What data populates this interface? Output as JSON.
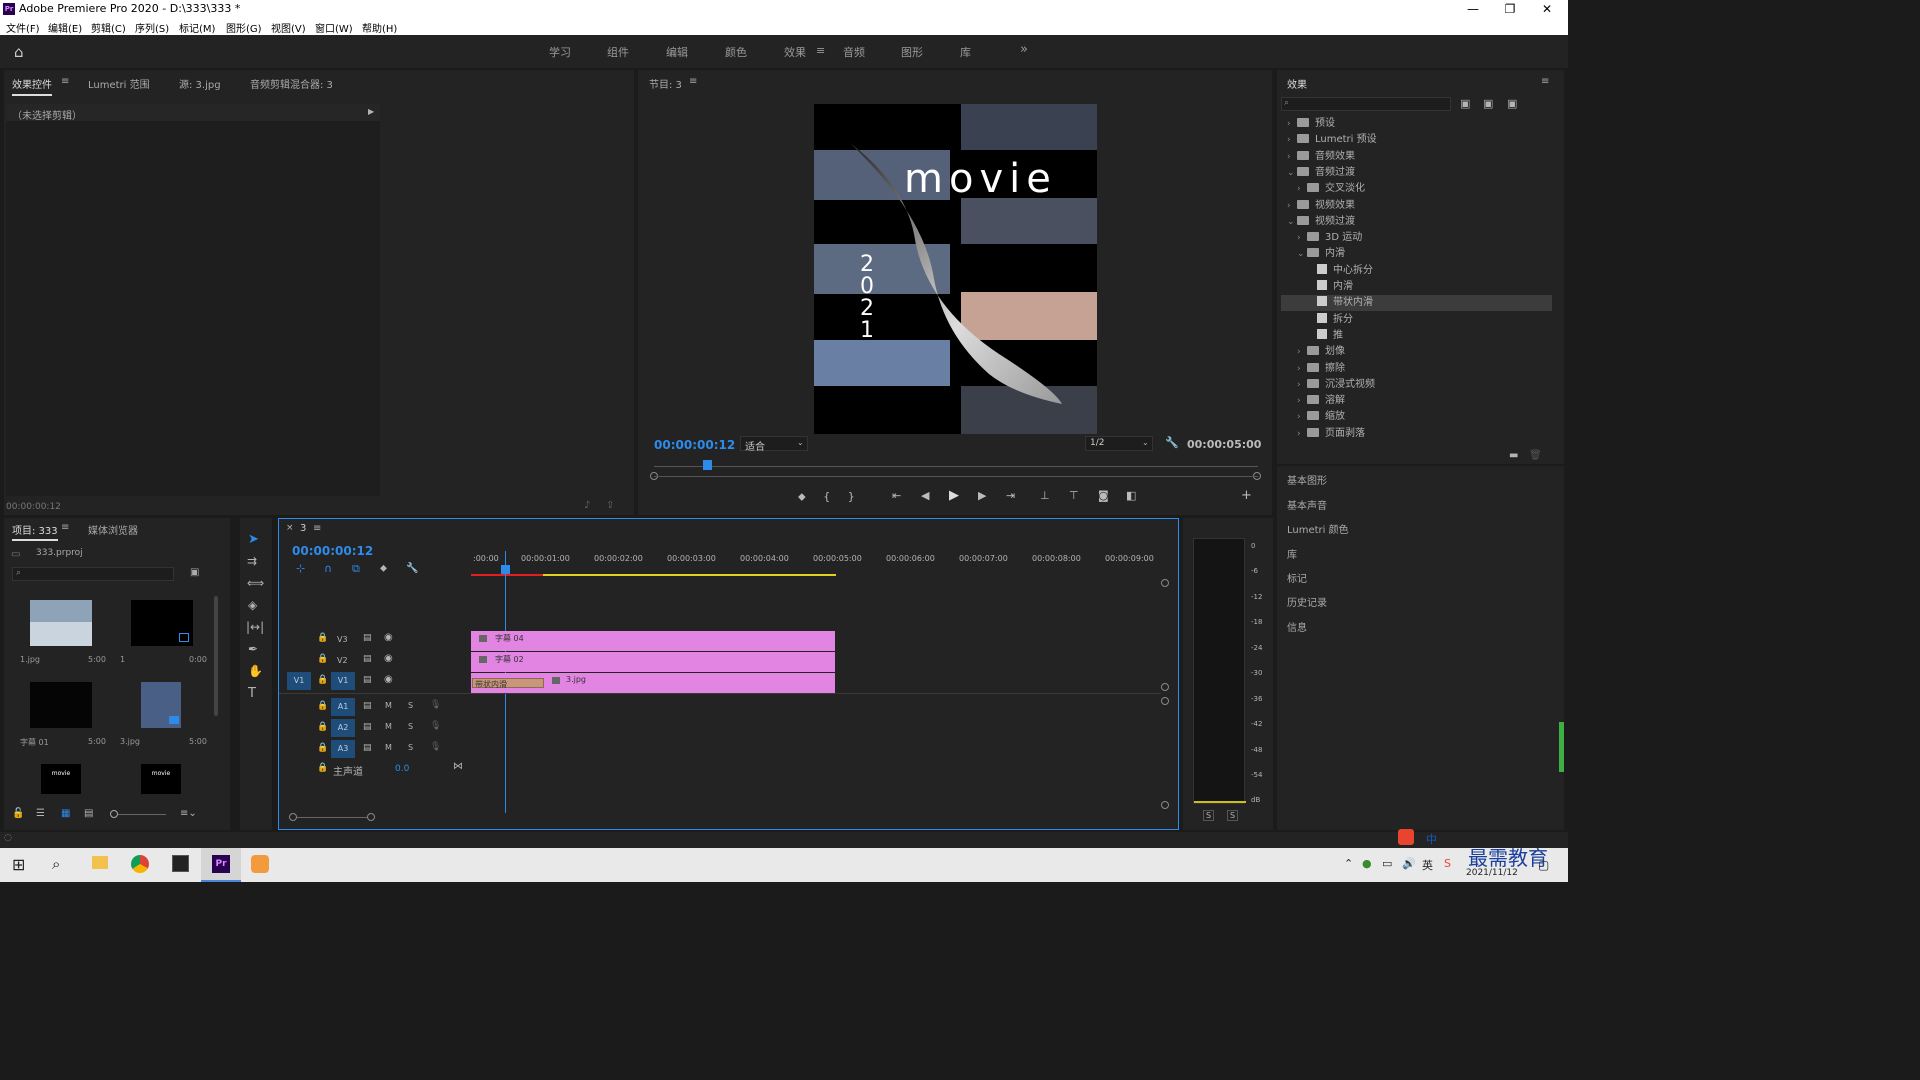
{
  "window": {
    "title": "Adobe Premiere Pro 2020 - D:\\333\\333 *",
    "logo": "Pr",
    "minimize": "—",
    "maximize": "❐",
    "close": "✕"
  },
  "menu": [
    "文件(F)",
    "编辑(E)",
    "剪辑(C)",
    "序列(S)",
    "标记(M)",
    "图形(G)",
    "视图(V)",
    "窗口(W)",
    "帮助(H)"
  ],
  "workspaces": [
    "学习",
    "组件",
    "编辑",
    "颜色",
    "效果",
    "音频",
    "图形",
    "库"
  ],
  "workspace_active": "效果",
  "source_panel": {
    "tabs": [
      "效果控件",
      "Lumetri 范围",
      "源: 3.jpg",
      "音频剪辑混合器: 3"
    ],
    "no_clip": "（未选择剪辑）",
    "timecode": "00:00:00:12"
  },
  "program": {
    "title": "节目: 3",
    "timecode": "00:00:00:12",
    "fit": "适合",
    "resolution": "1/2",
    "duration": "00:00:05:00",
    "overlay_title": "movie",
    "overlay_year": "2021"
  },
  "project": {
    "tabs": [
      "项目: 333",
      "媒体浏览器"
    ],
    "file": "333.prproj",
    "items": [
      {
        "name": "1.jpg",
        "dur": "5:00"
      },
      {
        "name": "1",
        "dur": "0:00"
      },
      {
        "name": "字幕 01",
        "dur": "5:00"
      },
      {
        "name": "3.jpg",
        "dur": "5:00"
      },
      {
        "name": "",
        "dur": ""
      },
      {
        "name": "",
        "dur": ""
      }
    ],
    "thumb_text": "movie"
  },
  "timeline": {
    "tab": "3",
    "timecode": "00:00:00:12",
    "ruler": [
      ":00:00",
      "00:00:01:00",
      "00:00:02:00",
      "00:00:03:00",
      "00:00:04:00",
      "00:00:05:00",
      "00:00:06:00",
      "00:00:07:00",
      "00:00:08:00",
      "00:00:09:00"
    ],
    "video_tracks": [
      "V3",
      "V2",
      "V1"
    ],
    "audio_tracks": [
      "A1",
      "A2",
      "A3"
    ],
    "src_patch": "V1",
    "master": "主声道",
    "master_val": "0.0",
    "clips": {
      "v3": "字幕 04",
      "v2": "字幕 02",
      "v1": "3.jpg",
      "transition": "带状内滑"
    },
    "track_btns": {
      "m": "M",
      "s": "S"
    }
  },
  "meter": {
    "scale": [
      "0",
      "-6",
      "-12",
      "-18",
      "-24",
      "-30",
      "-36",
      "-42",
      "-48",
      "-54",
      "dB"
    ],
    "solo": [
      "S",
      "S"
    ]
  },
  "effects": {
    "title": "效果",
    "tree": [
      {
        "label": "预设",
        "lvl": 0,
        "type": "bin",
        "open": false
      },
      {
        "label": "Lumetri 预设",
        "lvl": 0,
        "type": "bin",
        "open": false
      },
      {
        "label": "音频效果",
        "lvl": 0,
        "type": "folder",
        "open": false
      },
      {
        "label": "音频过渡",
        "lvl": 0,
        "type": "folder",
        "open": true
      },
      {
        "label": "交叉淡化",
        "lvl": 1,
        "type": "folder",
        "open": false
      },
      {
        "label": "视频效果",
        "lvl": 0,
        "type": "folder",
        "open": false
      },
      {
        "label": "视频过渡",
        "lvl": 0,
        "type": "folder",
        "open": true
      },
      {
        "label": "3D 运动",
        "lvl": 1,
        "type": "folder",
        "open": false
      },
      {
        "label": "内滑",
        "lvl": 1,
        "type": "folder",
        "open": true
      },
      {
        "label": "中心拆分",
        "lvl": 2,
        "type": "fx"
      },
      {
        "label": "内滑",
        "lvl": 2,
        "type": "fx"
      },
      {
        "label": "带状内滑",
        "lvl": 2,
        "type": "fx",
        "selected": true
      },
      {
        "label": "拆分",
        "lvl": 2,
        "type": "fx"
      },
      {
        "label": "推",
        "lvl": 2,
        "type": "fx"
      },
      {
        "label": "划像",
        "lvl": 1,
        "type": "folder",
        "open": false
      },
      {
        "label": "擦除",
        "lvl": 1,
        "type": "folder",
        "open": false
      },
      {
        "label": "沉浸式视频",
        "lvl": 1,
        "type": "folder",
        "open": false
      },
      {
        "label": "溶解",
        "lvl": 1,
        "type": "folder",
        "open": false
      },
      {
        "label": "缩放",
        "lvl": 1,
        "type": "folder",
        "open": false
      },
      {
        "label": "页面剥落",
        "lvl": 1,
        "type": "folder",
        "open": false
      }
    ],
    "panels": [
      "基本图形",
      "基本声音",
      "Lumetri 颜色",
      "库",
      "标记",
      "历史记录",
      "信息"
    ]
  },
  "taskbar": {
    "time": "2021/11/12",
    "watermark": "最需教育",
    "ime": "中"
  },
  "colors": {
    "accent": "#2d8ceb",
    "clip": "#e284e2",
    "transition": "#c9967a"
  }
}
